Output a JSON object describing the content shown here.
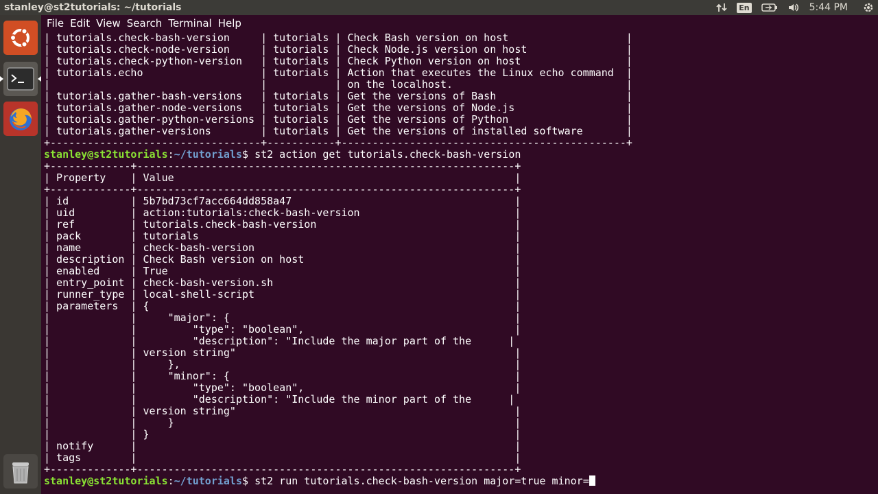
{
  "topbar": {
    "title": "stanley@st2tutorials: ~/tutorials",
    "language": "En",
    "time": "5:44 PM",
    "icons": [
      "network-transfer-icon",
      "keyboard-language-icon",
      "battery-icon",
      "volume-icon",
      "power-gear-icon"
    ]
  },
  "launcher": {
    "items": [
      {
        "name": "ubuntu-dash",
        "icon": "ubuntu-logo-icon"
      },
      {
        "name": "terminal",
        "icon": "terminal-icon"
      },
      {
        "name": "firefox",
        "icon": "firefox-icon"
      },
      {
        "name": "trash",
        "icon": "trash-icon"
      }
    ]
  },
  "menu": [
    "File",
    "Edit",
    "View",
    "Search",
    "Terminal",
    "Help"
  ],
  "colors": {
    "background": "#300a24",
    "prompt_user": "#8ae234",
    "prompt_dir": "#729fcf",
    "panel": "#3c3b37"
  },
  "terminal": {
    "lines": [
      "| tutorials.check-bash-version     | tutorials | Check Bash version on host                   |",
      "| tutorials.check-node-version     | tutorials | Check Node.js version on host                |",
      "| tutorials.check-python-version   | tutorials | Check Python version on host                 |",
      "| tutorials.echo                   | tutorials | Action that executes the Linux echo command  |",
      "|                                  |           | on the localhost.                            |",
      "| tutorials.gather-bash-versions   | tutorials | Get the versions of Bash                     |",
      "| tutorials.gather-node-versions   | tutorials | Get the versions of Node.js                  |",
      "| tutorials.gather-python-versions | tutorials | Get the versions of Python                   |",
      "| tutorials.gather-versions        | tutorials | Get the versions of installed software       |",
      "+----------------------------------+-----------+----------------------------------------------+",
      {
        "prompt_user": "stanley@st2tutorials",
        "prompt_sep": ":",
        "prompt_dir": "~/tutorials",
        "prompt_end": "$ ",
        "command": "st2 action get tutorials.check-bash-version"
      },
      "+-------------+-------------------------------------------------------------+",
      "| Property    | Value                                                       |",
      "+-------------+-------------------------------------------------------------+",
      "| id          | 5b7bd73cf7acc664dd858a47                                    |",
      "| uid         | action:tutorials:check-bash-version                         |",
      "| ref         | tutorials.check-bash-version                                |",
      "| pack        | tutorials                                                   |",
      "| name        | check-bash-version                                          |",
      "| description | Check Bash version on host                                  |",
      "| enabled     | True                                                        |",
      "| entry_point | check-bash-version.sh                                       |",
      "| runner_type | local-shell-script                                          |",
      "| parameters  | {                                                           |",
      "|             |     \"major\": {                                              |",
      "|             |         \"type\": \"boolean\",                                  |",
      "|             |         \"description\": \"Include the major part of the      |",
      "|             | version string\"                                             |",
      "|             |     },                                                      |",
      "|             |     \"minor\": {                                              |",
      "|             |         \"type\": \"boolean\",                                  |",
      "|             |         \"description\": \"Include the minor part of the      |",
      "|             | version string\"                                             |",
      "|             |     }                                                       |",
      "|             | }                                                           |",
      "| notify      |                                                             |",
      "| tags        |                                                             |",
      "+-------------+-------------------------------------------------------------+",
      {
        "prompt_user": "stanley@st2tutorials",
        "prompt_sep": ":",
        "prompt_dir": "~/tutorials",
        "prompt_end": "$ ",
        "command": "st2 run tutorials.check-bash-version major=true minor=",
        "cursor": true
      }
    ]
  }
}
